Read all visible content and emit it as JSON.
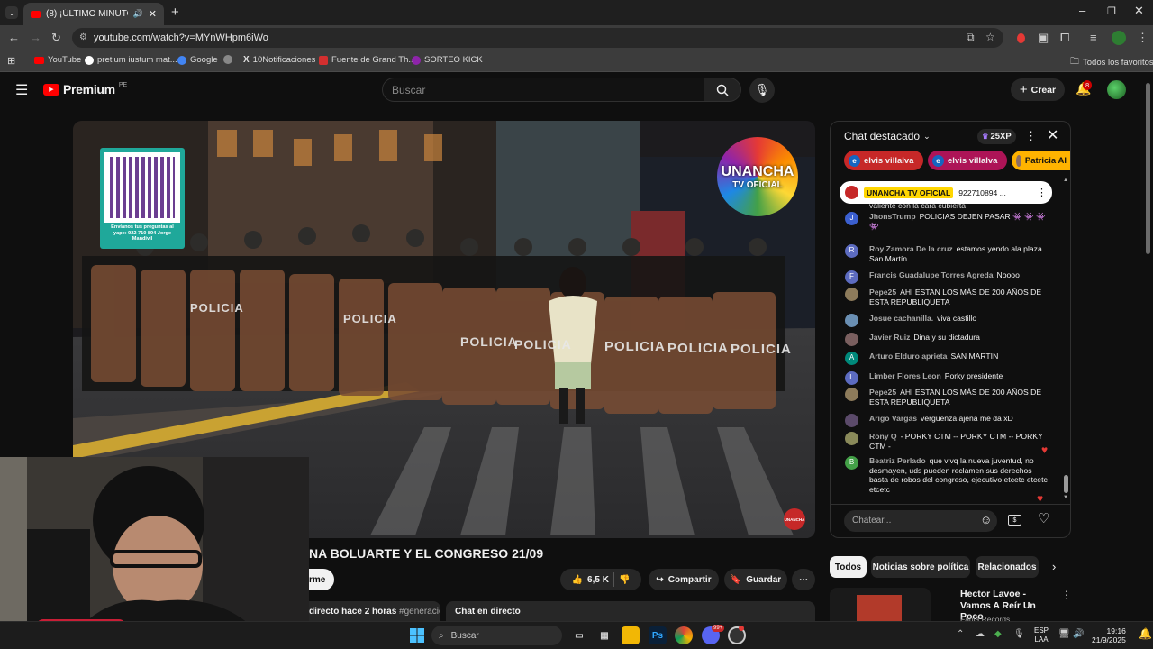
{
  "browser": {
    "tab_title": "(8) ¡ÚLTIMO MINUTO! M",
    "url": "youtube.com/watch?v=MYnWHpm6iWo",
    "bookmarks": [
      "YouTube",
      "pretium iustum mat...",
      "Google",
      "10Notificaciones",
      "Fuente de Grand Th...",
      "SORTEO KICK"
    ],
    "all_bookmarks": "Todos los favoritos"
  },
  "header": {
    "logo": "Premium",
    "region": "PE",
    "search_placeholder": "Buscar",
    "create": "Crear",
    "notifications_badge": "8"
  },
  "video": {
    "qr_caption": "Envíanos tus preguntas al yape: 922 710 894 Jorge Mandivil",
    "channel_logo_line1": "UNANCHA",
    "channel_logo_line2": "TV OFICIAL",
    "shield_text": "POLICIA",
    "corner_badge": "UNANCHA"
  },
  "below": {
    "title": "NA BOLUARTE Y EL CONGRESO 21/09",
    "subscribe_partial": "rme",
    "likes": "6,5 K",
    "share": "Compartir",
    "save": "Guardar",
    "meta": "directo hace 2 horas",
    "hashtag": "#generació",
    "chat_tab": "Chat en directo"
  },
  "chat": {
    "title": "Chat destacado",
    "xp": "25XP",
    "chips": [
      "elvis villalva",
      "elvis villalva",
      "Patricia Al"
    ],
    "pinned_author": "UNANCHA TV OFICIAL",
    "pinned_text": "922710894 ...",
    "partial_top": "valiente con la cara cubierta",
    "messages": [
      {
        "author": "JhonsTrump",
        "text": "POLICIAS DEJEN PASAR 👾 👾 👾 👾",
        "initial": "J",
        "color": "#3b5fcf"
      },
      {
        "author": "Roy Zamora De la cruz",
        "text": "estamos yendo ala plaza San Martín",
        "initial": "R",
        "color": "#5c6bc0"
      },
      {
        "author": "Francis Guadalupe Torres Agreda",
        "text": "Noooo",
        "initial": "F",
        "color": "#5c6bc0"
      },
      {
        "author": "Pepe25",
        "text": "AHI ESTAN LOS MÁS DE 200 AÑOS DE ESTA REPUBLIQUETA",
        "initial": "",
        "color": "#8d7b5b"
      },
      {
        "author": "Josue cachanilla.",
        "text": "viva castillo",
        "initial": "",
        "color": "#6a8fb3"
      },
      {
        "author": "Javier Ruiz",
        "text": "Dina y su dictadura",
        "initial": "",
        "color": "#7a5f5f"
      },
      {
        "author": "Arturo Elduro aprieta",
        "text": "SAN MARTIN",
        "initial": "A",
        "color": "#00897b"
      },
      {
        "author": "Limber Flores Leon",
        "text": "Porky presidente",
        "initial": "L",
        "color": "#5c6bc0"
      },
      {
        "author": "Pepe25",
        "text": "AHI ESTAN LOS MÁS DE 200 AÑOS DE ESTA REPUBLIQUETA",
        "initial": "",
        "color": "#8d7b5b"
      },
      {
        "author": "Arigo Vargas",
        "text": "vergüenza ajena me da xD",
        "initial": "",
        "color": "#5b4a6a"
      },
      {
        "author": "Rony Q",
        "text": "- PORKY CTM -- PORKY CTM -- PORKY CTM -",
        "initial": "",
        "color": "#8a8a5a"
      },
      {
        "author": "Beatriz Perlado",
        "text": "que vivq la nueva juventud, no desmayen, uds pueden reclamen sus derechos basta de robos del congreso, ejecutivo etcetc etcetc etcetc",
        "initial": "B",
        "color": "#43a047"
      }
    ],
    "input_placeholder": "Chatear..."
  },
  "related": {
    "chips": [
      "Todos",
      "Noticias sobre política",
      "Relacionados"
    ],
    "video_title": "Hector Lavoe - Vamos A Reír Un Poco",
    "video_channel": "Fania Records"
  },
  "taskbar": {
    "search": "Buscar",
    "lang1": "ESP",
    "lang2": "LAA",
    "time": "19:16",
    "date": "21/9/2025",
    "badge": "99+"
  }
}
